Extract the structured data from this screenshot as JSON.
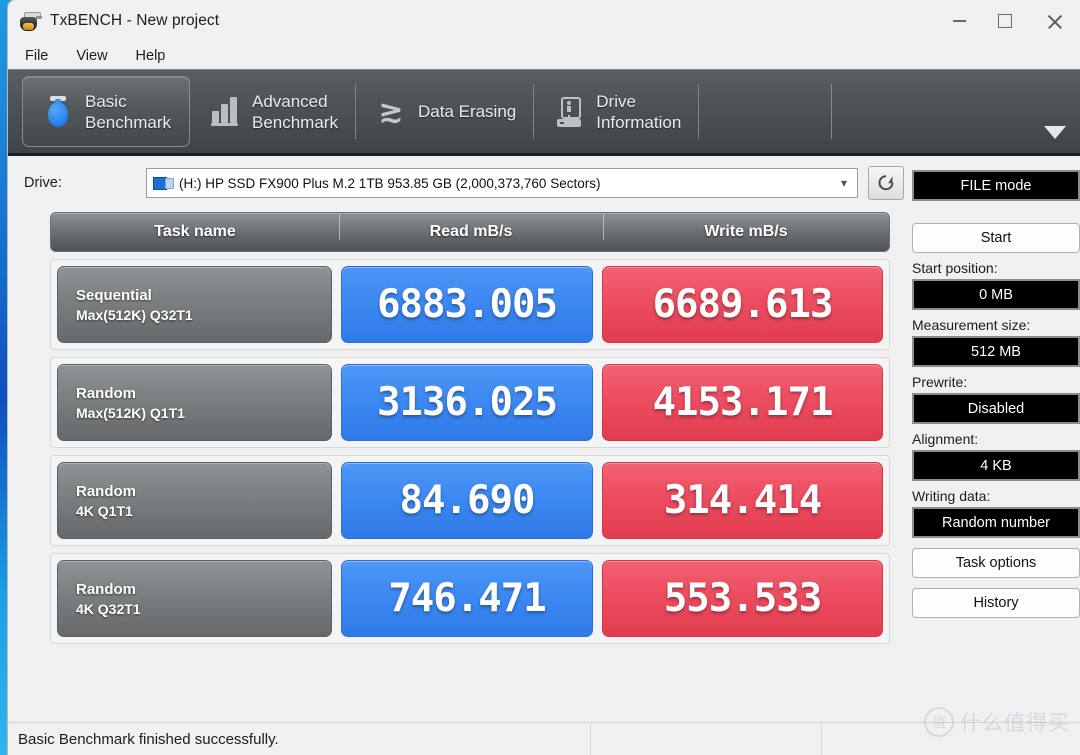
{
  "window": {
    "title": "TxBENCH - New project",
    "app_icon": "txbench-icon",
    "minimize": "minimize-icon",
    "maximize": "maximize-icon",
    "close": "close-icon"
  },
  "menu": {
    "items": [
      {
        "label": "File"
      },
      {
        "label": "View"
      },
      {
        "label": "Help"
      }
    ]
  },
  "ribbon": {
    "tabs": [
      {
        "label": "Basic\nBenchmark",
        "icon": "stopwatch-icon",
        "active": true
      },
      {
        "label": "Advanced\nBenchmark",
        "icon": "bar-chart-icon",
        "active": false
      },
      {
        "label": "Data Erasing",
        "icon": "erase-zigzag-icon",
        "active": false
      },
      {
        "label": "Drive\nInformation",
        "icon": "drive-info-icon",
        "active": false
      }
    ],
    "more_icon": "chevron-down-icon"
  },
  "drive": {
    "label": "Drive:",
    "value": "(H:) HP SSD FX900 Plus M.2 1TB  953.85 GB (2,000,373,760 Sectors)",
    "icon": "drive-monitor-icon",
    "caret": "chevron-down-icon",
    "refresh_icon": "refresh-icon"
  },
  "table": {
    "headers": [
      "Task name",
      "Read mB/s",
      "Write mB/s"
    ],
    "rows": [
      {
        "name_line1": "Sequential",
        "name_line2": "Max(512K) Q32T1",
        "read": "6883.005",
        "write": "6689.613"
      },
      {
        "name_line1": "Random",
        "name_line2": "Max(512K) Q1T1",
        "read": "3136.025",
        "write": "4153.171"
      },
      {
        "name_line1": "Random",
        "name_line2": "4K Q1T1",
        "read": "84.690",
        "write": "314.414"
      },
      {
        "name_line1": "Random",
        "name_line2": "4K Q32T1",
        "read": "746.471",
        "write": "553.533"
      }
    ]
  },
  "sidebar": {
    "mode_value": "FILE mode",
    "start_label": "Start",
    "start_position_caption": "Start position:",
    "start_position_value": "0 MB",
    "measurement_caption": "Measurement size:",
    "measurement_value": "512 MB",
    "prewrite_caption": "Prewrite:",
    "prewrite_value": "Disabled",
    "alignment_caption": "Alignment:",
    "alignment_value": "4 KB",
    "writing_data_caption": "Writing data:",
    "writing_data_value": "Random number",
    "task_options_label": "Task options",
    "history_label": "History"
  },
  "statusbar": {
    "message": "Basic Benchmark finished successfully."
  },
  "watermark": {
    "badge": "值",
    "text": "什么值得买"
  },
  "colors": {
    "read_blue": "#3d89f2",
    "write_red": "#ec4d60",
    "ribbon_dark": "#4e5357",
    "field_black": "#000000",
    "window_bg": "#f0f0f0"
  }
}
